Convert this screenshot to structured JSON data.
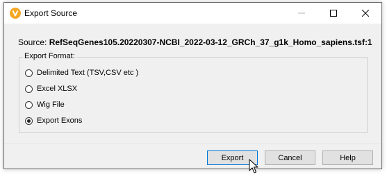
{
  "window": {
    "title": "Export Source"
  },
  "source": {
    "label": "Source:",
    "value": "RefSeqGenes105.20220307-NCBI_2022-03-12_GRCh_37_g1k_Homo_sapiens.tsf:1"
  },
  "export_format": {
    "legend": "Export Format:",
    "options": [
      {
        "label": "Delimited Text (TSV,CSV etc )",
        "checked": false
      },
      {
        "label": "Excel XLSX",
        "checked": false
      },
      {
        "label": "Wig File",
        "checked": false
      },
      {
        "label": "Export Exons",
        "checked": true
      }
    ]
  },
  "buttons": {
    "export": "Export",
    "cancel": "Cancel",
    "help": "Help"
  },
  "icons": {
    "app": "golden-helix-icon",
    "minimize": "minimize-icon",
    "maximize": "maximize-icon",
    "close": "close-icon",
    "cursor": "mouse-pointer-icon"
  },
  "colors": {
    "accent": "#f5a623",
    "focus_border": "#0078d7"
  }
}
